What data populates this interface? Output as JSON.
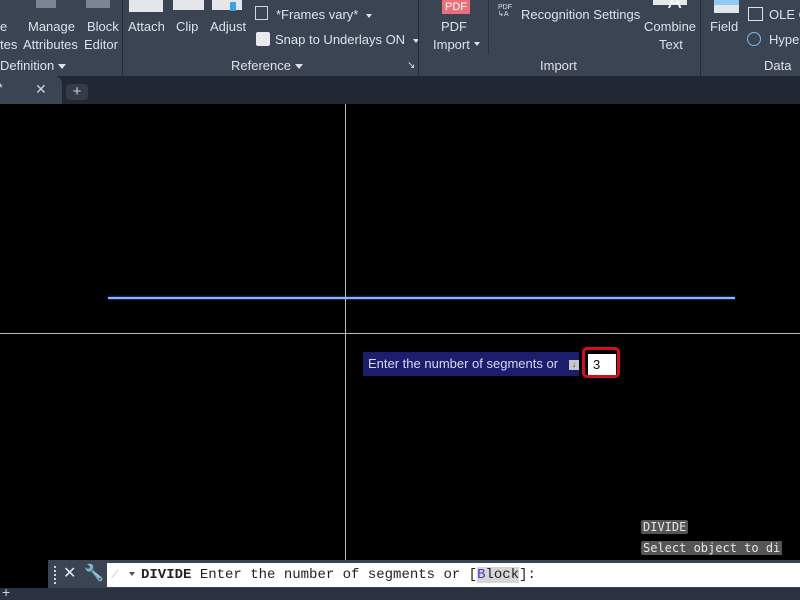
{
  "ribbon": {
    "block_definition": {
      "partial_button_top": "e",
      "partial_button_bottom": "tes",
      "manage_attributes": [
        "Manage",
        "Attributes"
      ],
      "block_editor": [
        "Block",
        "Editor"
      ],
      "panel_title": "Definition"
    },
    "reference": {
      "attach": "Attach",
      "clip": "Clip",
      "adjust": "Adjust",
      "frames": "*Frames vary*",
      "snap": "Snap to Underlays ON",
      "panel_title": "Reference"
    },
    "import": {
      "pdf_icon_text": "PDF",
      "pdf_import": [
        "PDF",
        "Import"
      ],
      "recognition_settings": "Recognition Settings",
      "combine_text": [
        "Combine",
        "Text"
      ],
      "panel_title": "Import"
    },
    "data": {
      "field": "Field",
      "ole": "OLE O",
      "hyperlink": "Hyper",
      "panel_title": "Data"
    }
  },
  "tabs": {
    "close_glyph": "✕",
    "new_tab_glyph": "+"
  },
  "drawing": {
    "line_color": "#8fb3ff",
    "crosshair_color": "#b9b9b9"
  },
  "dynamic_input": {
    "prompt": "Enter the number of segments or",
    "value": "3",
    "highlight_color": "#d0101a"
  },
  "command_history": [
    "DIVIDE",
    "Select object to di"
  ],
  "command_line": {
    "command": "DIVIDE",
    "prompt_before": "Enter the number of segments or [",
    "option_key": "B",
    "option_rest": "lock",
    "prompt_after": "]:",
    "close_glyph": "✕"
  },
  "status": {
    "add_glyph": "+"
  }
}
